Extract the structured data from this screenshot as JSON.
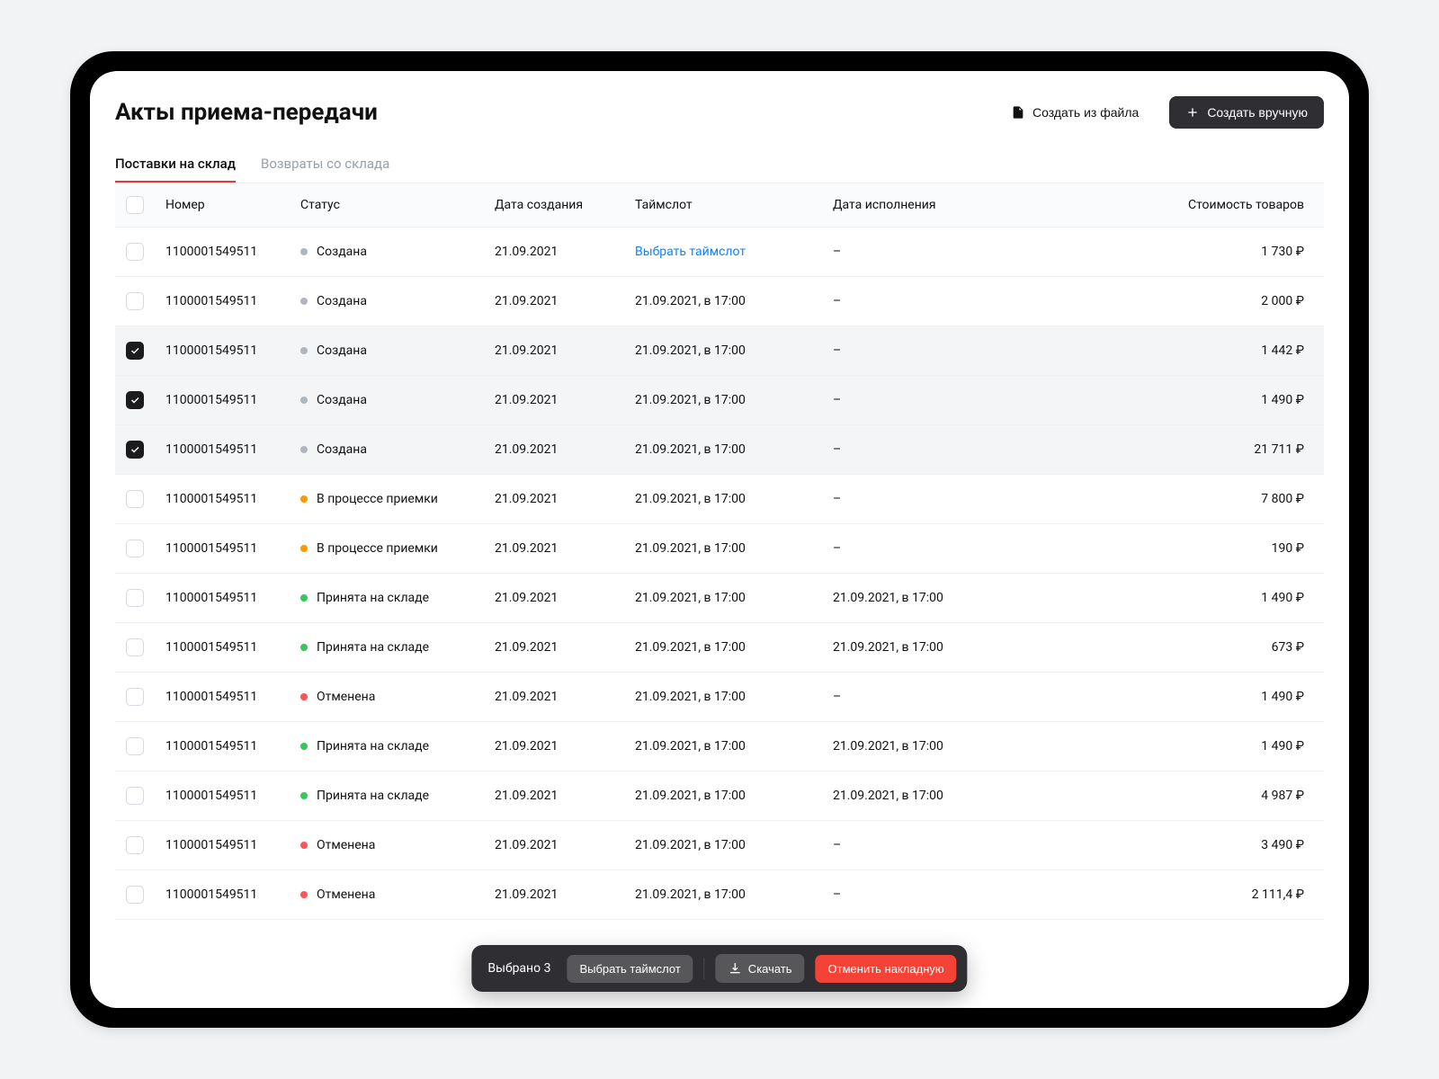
{
  "header": {
    "title": "Акты приема-передачи",
    "create_from_file": "Создать из файла",
    "create_manual": "Создать вручную"
  },
  "tabs": [
    {
      "label": "Поставки на склад",
      "active": true
    },
    {
      "label": "Возвраты со склада",
      "active": false
    }
  ],
  "columns": {
    "number": "Номер",
    "status": "Статус",
    "created": "Дата создания",
    "slot": "Таймслот",
    "exec": "Дата исполнения",
    "price": "Стоимость товаров"
  },
  "choose_slot_label": "Выбрать таймслот",
  "dash": "–",
  "status_labels": {
    "created": "Создана",
    "in_progress": "В процессе приемки",
    "accepted": "Принята на складе",
    "cancelled": "Отменена"
  },
  "status_colors": {
    "created": "gray",
    "in_progress": "orange",
    "accepted": "green",
    "cancelled": "red"
  },
  "rows": [
    {
      "checked": false,
      "number": "1100001549511",
      "status": "created",
      "created": "21.09.2021",
      "slot_link": true,
      "slot": "",
      "exec": "",
      "price": "1 730 ₽"
    },
    {
      "checked": false,
      "number": "1100001549511",
      "status": "created",
      "created": "21.09.2021",
      "slot": "21.09.2021, в 17:00",
      "exec": "",
      "price": "2 000 ₽"
    },
    {
      "checked": true,
      "number": "1100001549511",
      "status": "created",
      "created": "21.09.2021",
      "slot": "21.09.2021, в 17:00",
      "exec": "",
      "price": "1 442 ₽"
    },
    {
      "checked": true,
      "number": "1100001549511",
      "status": "created",
      "created": "21.09.2021",
      "slot": "21.09.2021, в 17:00",
      "exec": "",
      "price": "1 490 ₽"
    },
    {
      "checked": true,
      "number": "1100001549511",
      "status": "created",
      "created": "21.09.2021",
      "slot": "21.09.2021, в 17:00",
      "exec": "",
      "price": "21 711 ₽"
    },
    {
      "checked": false,
      "number": "1100001549511",
      "status": "in_progress",
      "created": "21.09.2021",
      "slot": "21.09.2021, в 17:00",
      "exec": "",
      "price": "7 800 ₽"
    },
    {
      "checked": false,
      "number": "1100001549511",
      "status": "in_progress",
      "created": "21.09.2021",
      "slot": "21.09.2021, в 17:00",
      "exec": "",
      "price": "190 ₽"
    },
    {
      "checked": false,
      "number": "1100001549511",
      "status": "accepted",
      "created": "21.09.2021",
      "slot": "21.09.2021, в 17:00",
      "exec": "21.09.2021, в 17:00",
      "price": "1 490 ₽"
    },
    {
      "checked": false,
      "number": "1100001549511",
      "status": "accepted",
      "created": "21.09.2021",
      "slot": "21.09.2021, в 17:00",
      "exec": "21.09.2021, в 17:00",
      "price": "673 ₽"
    },
    {
      "checked": false,
      "number": "1100001549511",
      "status": "cancelled",
      "created": "21.09.2021",
      "slot": "21.09.2021, в 17:00",
      "exec": "",
      "price": "1 490 ₽"
    },
    {
      "checked": false,
      "number": "1100001549511",
      "status": "accepted",
      "created": "21.09.2021",
      "slot": "21.09.2021, в 17:00",
      "exec": "21.09.2021, в 17:00",
      "price": "1 490 ₽"
    },
    {
      "checked": false,
      "number": "1100001549511",
      "status": "accepted",
      "created": "21.09.2021",
      "slot": "21.09.2021, в 17:00",
      "exec": "21.09.2021, в 17:00",
      "price": "4 987 ₽"
    },
    {
      "checked": false,
      "number": "1100001549511",
      "status": "cancelled",
      "created": "21.09.2021",
      "slot": "21.09.2021, в 17:00",
      "exec": "",
      "price": "3 490 ₽"
    },
    {
      "checked": false,
      "number": "1100001549511",
      "status": "cancelled",
      "created": "21.09.2021",
      "slot": "21.09.2021, в 17:00",
      "exec": "",
      "price": "2 111,4 ₽"
    }
  ],
  "toolbar": {
    "selected_prefix": "Выбрано ",
    "selected_count": "3",
    "choose_slot": "Выбрать таймслот",
    "download": "Скачать",
    "cancel": "Отменить накладную"
  }
}
